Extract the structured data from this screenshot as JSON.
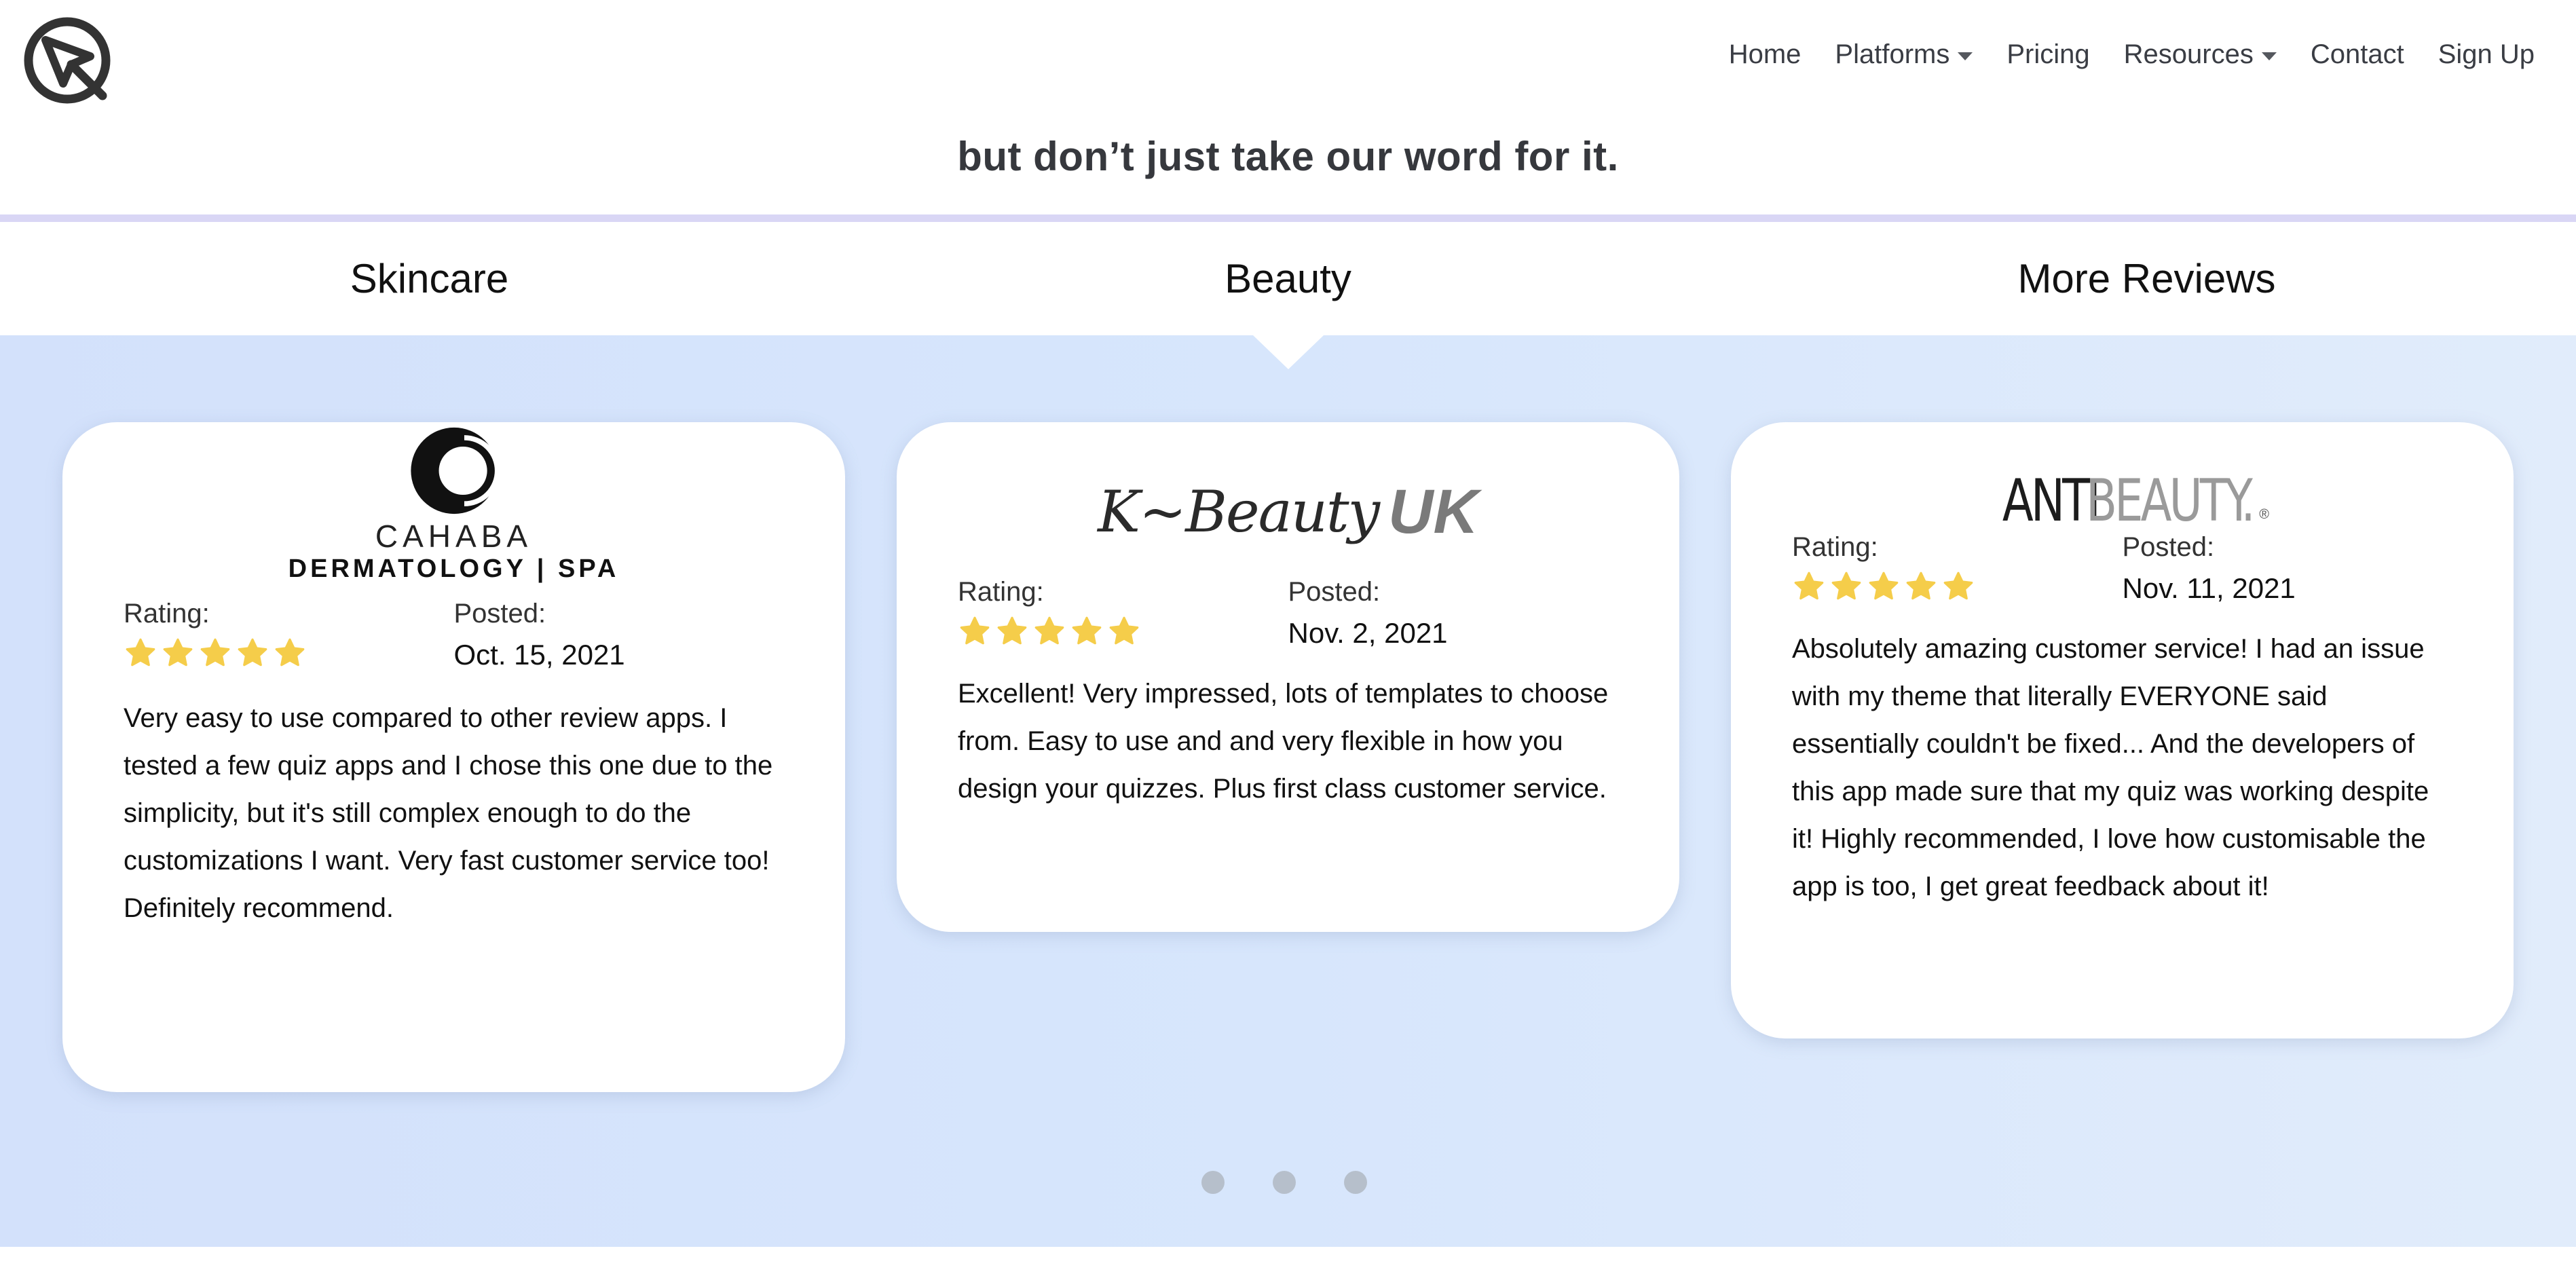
{
  "nav": {
    "logo_icon": "cursor-circle-logo",
    "items": [
      {
        "label": "Home",
        "has_dropdown": false
      },
      {
        "label": "Platforms",
        "has_dropdown": true
      },
      {
        "label": "Pricing",
        "has_dropdown": false
      },
      {
        "label": "Resources",
        "has_dropdown": true
      },
      {
        "label": "Contact",
        "has_dropdown": false
      },
      {
        "label": "Sign Up",
        "has_dropdown": false
      }
    ]
  },
  "tagline": "but don’t just take our word for it.",
  "tabs": [
    {
      "label": "Skincare"
    },
    {
      "label": "Beauty",
      "active": true
    },
    {
      "label": "More Reviews"
    }
  ],
  "reviews": [
    {
      "brand": "CAHABA DERMATOLOGY | SPA",
      "brand_line1": "CAHABA",
      "brand_line2": "DERMATOLOGY | SPA",
      "rating_label": "Rating:",
      "rating": 5,
      "posted_label": "Posted:",
      "posted": "Oct. 15, 2021",
      "text": "Very easy to use compared to other review apps. I tested a few quiz apps and I chose this one due to the simplicity, but it's still complex enough to do the customizations I want. Very fast customer service too! Definitely recommend."
    },
    {
      "brand": "K-Beauty UK",
      "brand_script": "K~Beauty",
      "brand_bold": "UK",
      "rating_label": "Rating:",
      "rating": 5,
      "posted_label": "Posted:",
      "posted": "Nov. 2, 2021",
      "text": "Excellent! Very impressed, lots of templates to choose from. Easy to use and and very flexible in how you design your quizzes. Plus first class customer service."
    },
    {
      "brand": "ANTIBEAUTY.",
      "brand_dark": "ANTI",
      "brand_light": "BEAUTY.",
      "brand_mark": "®",
      "rating_label": "Rating:",
      "rating": 5,
      "posted_label": "Posted:",
      "posted": "Nov. 11, 2021",
      "text": "Absolutely amazing customer service! I had an issue with my theme that literally EVERYONE said essentially couldn't be fixed... And the developers of this app made sure that my quiz was working despite it! Highly recommended, I love how customisable the app is too, I get great feedback about it!"
    }
  ],
  "carousel": {
    "pages": 3,
    "current": 2
  },
  "colors": {
    "star": "#f5cd4a",
    "divider": "#d9d6f5",
    "dot": "#b6bfcb",
    "background_gradient_start": "#d3e1fb",
    "background_gradient_end": "#e1ecfb"
  }
}
